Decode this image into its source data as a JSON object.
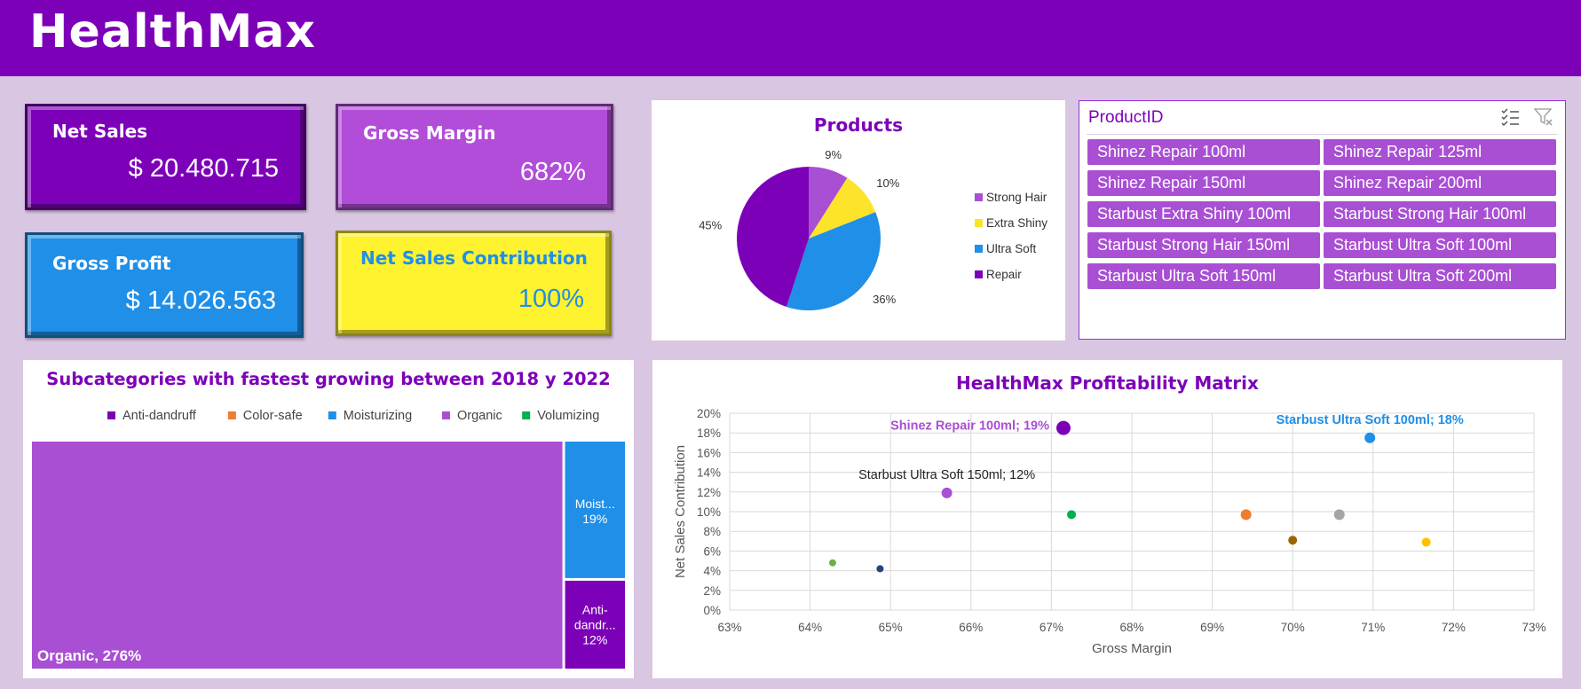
{
  "header": {
    "title": "HealthMax"
  },
  "kpis": {
    "net_sales": {
      "label": "Net Sales",
      "value": "$ 20.480.715"
    },
    "gross_margin": {
      "label": "Gross Margin",
      "value": "682%"
    },
    "gross_profit": {
      "label": "Gross Profit",
      "value": "$ 14.026.563"
    },
    "net_sales_contribution": {
      "label": "Net Sales Contribution",
      "value": "100%"
    }
  },
  "colors": {
    "purple": "#7d00b9",
    "violet": "#a94fd4",
    "blue": "#1f8fe8",
    "yellow": "#fff22e",
    "orange": "#ed7d31",
    "green": "#00b050"
  },
  "slicer": {
    "title": "ProductID",
    "items": [
      "Shinez Repair 100ml",
      "Shinez Repair 125ml",
      "Shinez Repair 150ml",
      "Shinez Repair 200ml",
      "Starbust Extra Shiny 100ml",
      "Starbust Strong Hair 100ml",
      "Starbust Strong Hair 150ml",
      "Starbust Ultra Soft 100ml",
      "Starbust Ultra Soft 150ml",
      "Starbust Ultra Soft 200ml"
    ],
    "icons": [
      "multi-select-icon",
      "clear-filter-icon"
    ]
  },
  "chart_data": [
    {
      "type": "pie",
      "title": "Products",
      "slices": [
        {
          "name": "Strong Hair",
          "value": 9,
          "label": "9%",
          "color": "#a94fd4"
        },
        {
          "name": "Extra Shiny",
          "value": 10,
          "label": "10%",
          "color": "#fde42a"
        },
        {
          "name": "Ultra Soft",
          "value": 36,
          "label": "36%",
          "color": "#1f8fe8"
        },
        {
          "name": "Repair",
          "value": 45,
          "label": "45%",
          "color": "#7d00b9"
        }
      ],
      "legend": [
        "Strong Hair",
        "Extra Shiny",
        "Ultra Soft",
        "Repair"
      ],
      "legend_position": "right"
    },
    {
      "type": "treemap",
      "title": "Subcategories with fastest growing between 2018 y 2022",
      "legend": [
        {
          "name": "Anti-dandruff",
          "color": "#7d00b9"
        },
        {
          "name": "Color-safe",
          "color": "#ed7d31"
        },
        {
          "name": "Moisturizing",
          "color": "#1f8fe8"
        },
        {
          "name": "Organic",
          "color": "#a94fd4"
        },
        {
          "name": "Volumizing",
          "color": "#00b050"
        }
      ],
      "legend_position": "top",
      "items": [
        {
          "name": "Organic",
          "value": 276,
          "label": "Organic, 276%",
          "color": "#a94fd4"
        },
        {
          "name": "Moisturizing",
          "value": 19,
          "label_lines": [
            "Moist...",
            "19%"
          ],
          "color": "#1f8fe8"
        },
        {
          "name": "Anti-dandruff",
          "value": 12,
          "label_lines": [
            "Anti-",
            "dandr...",
            "12%"
          ],
          "color": "#7d00b9"
        }
      ]
    },
    {
      "type": "scatter",
      "title": "HealthMax Profitability Matrix",
      "xlabel": "Gross Margin",
      "ylabel": "Net Sales Contribution",
      "xlim": [
        0.63,
        0.73
      ],
      "ylim": [
        0,
        0.2
      ],
      "x_ticks": [
        "63%",
        "64%",
        "65%",
        "66%",
        "67%",
        "68%",
        "69%",
        "70%",
        "71%",
        "72%",
        "73%"
      ],
      "y_ticks": [
        "0%",
        "2%",
        "4%",
        "6%",
        "8%",
        "10%",
        "12%",
        "14%",
        "16%",
        "18%",
        "20%"
      ],
      "grid": true,
      "points": [
        {
          "x": 0.6715,
          "y": 0.185,
          "color": "#7d00b9",
          "r": 8,
          "label": "Shinez Repair 100ml; 19%",
          "label_color": "#a94fd4",
          "label_bold": true,
          "label_anchor": "left"
        },
        {
          "x": 0.7096,
          "y": 0.175,
          "color": "#1f8fe8",
          "r": 6,
          "label": "Starbust Ultra Soft 100ml; 18%",
          "label_color": "#1f8fe8",
          "label_bold": true,
          "label_anchor": "above"
        },
        {
          "x": 0.657,
          "y": 0.119,
          "color": "#a94fd4",
          "r": 6,
          "label": "Starbust Ultra Soft 150ml; 12%",
          "label_color": "#222222",
          "label_bold": false,
          "label_anchor": "above"
        },
        {
          "x": 0.6725,
          "y": 0.097,
          "color": "#00b050",
          "r": 5
        },
        {
          "x": 0.6942,
          "y": 0.097,
          "color": "#ed7d31",
          "r": 6
        },
        {
          "x": 0.7058,
          "y": 0.097,
          "color": "#a5a5a5",
          "r": 6
        },
        {
          "x": 0.7,
          "y": 0.071,
          "color": "#9c6500",
          "r": 5
        },
        {
          "x": 0.7166,
          "y": 0.069,
          "color": "#ffc000",
          "r": 5
        },
        {
          "x": 0.6428,
          "y": 0.048,
          "color": "#70ad47",
          "r": 4
        },
        {
          "x": 0.6487,
          "y": 0.042,
          "color": "#264478",
          "r": 4
        }
      ]
    }
  ]
}
